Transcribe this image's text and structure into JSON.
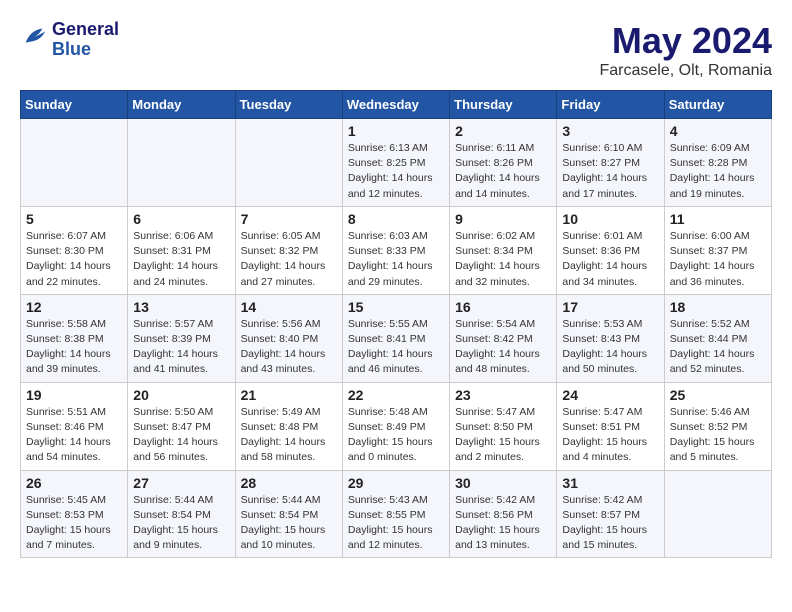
{
  "header": {
    "logo_line1": "General",
    "logo_line2": "Blue",
    "month_year": "May 2024",
    "location": "Farcasele, Olt, Romania"
  },
  "days_of_week": [
    "Sunday",
    "Monday",
    "Tuesday",
    "Wednesday",
    "Thursday",
    "Friday",
    "Saturday"
  ],
  "weeks": [
    [
      {
        "day": "",
        "info": ""
      },
      {
        "day": "",
        "info": ""
      },
      {
        "day": "",
        "info": ""
      },
      {
        "day": "1",
        "info": "Sunrise: 6:13 AM\nSunset: 8:25 PM\nDaylight: 14 hours\nand 12 minutes."
      },
      {
        "day": "2",
        "info": "Sunrise: 6:11 AM\nSunset: 8:26 PM\nDaylight: 14 hours\nand 14 minutes."
      },
      {
        "day": "3",
        "info": "Sunrise: 6:10 AM\nSunset: 8:27 PM\nDaylight: 14 hours\nand 17 minutes."
      },
      {
        "day": "4",
        "info": "Sunrise: 6:09 AM\nSunset: 8:28 PM\nDaylight: 14 hours\nand 19 minutes."
      }
    ],
    [
      {
        "day": "5",
        "info": "Sunrise: 6:07 AM\nSunset: 8:30 PM\nDaylight: 14 hours\nand 22 minutes."
      },
      {
        "day": "6",
        "info": "Sunrise: 6:06 AM\nSunset: 8:31 PM\nDaylight: 14 hours\nand 24 minutes."
      },
      {
        "day": "7",
        "info": "Sunrise: 6:05 AM\nSunset: 8:32 PM\nDaylight: 14 hours\nand 27 minutes."
      },
      {
        "day": "8",
        "info": "Sunrise: 6:03 AM\nSunset: 8:33 PM\nDaylight: 14 hours\nand 29 minutes."
      },
      {
        "day": "9",
        "info": "Sunrise: 6:02 AM\nSunset: 8:34 PM\nDaylight: 14 hours\nand 32 minutes."
      },
      {
        "day": "10",
        "info": "Sunrise: 6:01 AM\nSunset: 8:36 PM\nDaylight: 14 hours\nand 34 minutes."
      },
      {
        "day": "11",
        "info": "Sunrise: 6:00 AM\nSunset: 8:37 PM\nDaylight: 14 hours\nand 36 minutes."
      }
    ],
    [
      {
        "day": "12",
        "info": "Sunrise: 5:58 AM\nSunset: 8:38 PM\nDaylight: 14 hours\nand 39 minutes."
      },
      {
        "day": "13",
        "info": "Sunrise: 5:57 AM\nSunset: 8:39 PM\nDaylight: 14 hours\nand 41 minutes."
      },
      {
        "day": "14",
        "info": "Sunrise: 5:56 AM\nSunset: 8:40 PM\nDaylight: 14 hours\nand 43 minutes."
      },
      {
        "day": "15",
        "info": "Sunrise: 5:55 AM\nSunset: 8:41 PM\nDaylight: 14 hours\nand 46 minutes."
      },
      {
        "day": "16",
        "info": "Sunrise: 5:54 AM\nSunset: 8:42 PM\nDaylight: 14 hours\nand 48 minutes."
      },
      {
        "day": "17",
        "info": "Sunrise: 5:53 AM\nSunset: 8:43 PM\nDaylight: 14 hours\nand 50 minutes."
      },
      {
        "day": "18",
        "info": "Sunrise: 5:52 AM\nSunset: 8:44 PM\nDaylight: 14 hours\nand 52 minutes."
      }
    ],
    [
      {
        "day": "19",
        "info": "Sunrise: 5:51 AM\nSunset: 8:46 PM\nDaylight: 14 hours\nand 54 minutes."
      },
      {
        "day": "20",
        "info": "Sunrise: 5:50 AM\nSunset: 8:47 PM\nDaylight: 14 hours\nand 56 minutes."
      },
      {
        "day": "21",
        "info": "Sunrise: 5:49 AM\nSunset: 8:48 PM\nDaylight: 14 hours\nand 58 minutes."
      },
      {
        "day": "22",
        "info": "Sunrise: 5:48 AM\nSunset: 8:49 PM\nDaylight: 15 hours\nand 0 minutes."
      },
      {
        "day": "23",
        "info": "Sunrise: 5:47 AM\nSunset: 8:50 PM\nDaylight: 15 hours\nand 2 minutes."
      },
      {
        "day": "24",
        "info": "Sunrise: 5:47 AM\nSunset: 8:51 PM\nDaylight: 15 hours\nand 4 minutes."
      },
      {
        "day": "25",
        "info": "Sunrise: 5:46 AM\nSunset: 8:52 PM\nDaylight: 15 hours\nand 5 minutes."
      }
    ],
    [
      {
        "day": "26",
        "info": "Sunrise: 5:45 AM\nSunset: 8:53 PM\nDaylight: 15 hours\nand 7 minutes."
      },
      {
        "day": "27",
        "info": "Sunrise: 5:44 AM\nSunset: 8:54 PM\nDaylight: 15 hours\nand 9 minutes."
      },
      {
        "day": "28",
        "info": "Sunrise: 5:44 AM\nSunset: 8:54 PM\nDaylight: 15 hours\nand 10 minutes."
      },
      {
        "day": "29",
        "info": "Sunrise: 5:43 AM\nSunset: 8:55 PM\nDaylight: 15 hours\nand 12 minutes."
      },
      {
        "day": "30",
        "info": "Sunrise: 5:42 AM\nSunset: 8:56 PM\nDaylight: 15 hours\nand 13 minutes."
      },
      {
        "day": "31",
        "info": "Sunrise: 5:42 AM\nSunset: 8:57 PM\nDaylight: 15 hours\nand 15 minutes."
      },
      {
        "day": "",
        "info": ""
      }
    ]
  ]
}
